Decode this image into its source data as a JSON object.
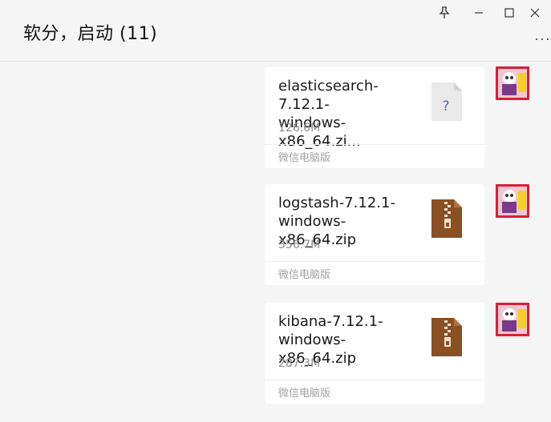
{
  "header": {
    "title": "软分，启动 (11)"
  },
  "window_controls": {
    "pin_icon": "pin-icon",
    "minimize_icon": "minimize-icon",
    "maximize_icon": "maximize-icon",
    "close_icon": "close-icon"
  },
  "more_label": "···",
  "messages": [
    {
      "file_name": "elasticsearch-7.12.1-windows-x86_64.zi...",
      "file_name_line1": "elasticsearch-7.12.1-",
      "file_name_line2": "windows-x86_64.zi...",
      "size": "126.6M",
      "source": "微信电脑版",
      "icon": "unknown-file-icon"
    },
    {
      "file_name_line1": "logstash-7.12.1-",
      "file_name_line2": "windows-x86_64.zip",
      "size": "356.7M",
      "source": "微信电脑版",
      "icon": "zip-file-icon"
    },
    {
      "file_name_line1": "kibana-7.12.1-",
      "file_name_line2": "windows-x86_64.zip",
      "size": "287.3M",
      "source": "微信电脑版",
      "icon": "zip-file-icon"
    }
  ],
  "colors": {
    "background": "#f5f5f5",
    "bubble": "#ffffff",
    "zip_brown": "#8a4f22",
    "avatar_red": "#d8203a"
  }
}
